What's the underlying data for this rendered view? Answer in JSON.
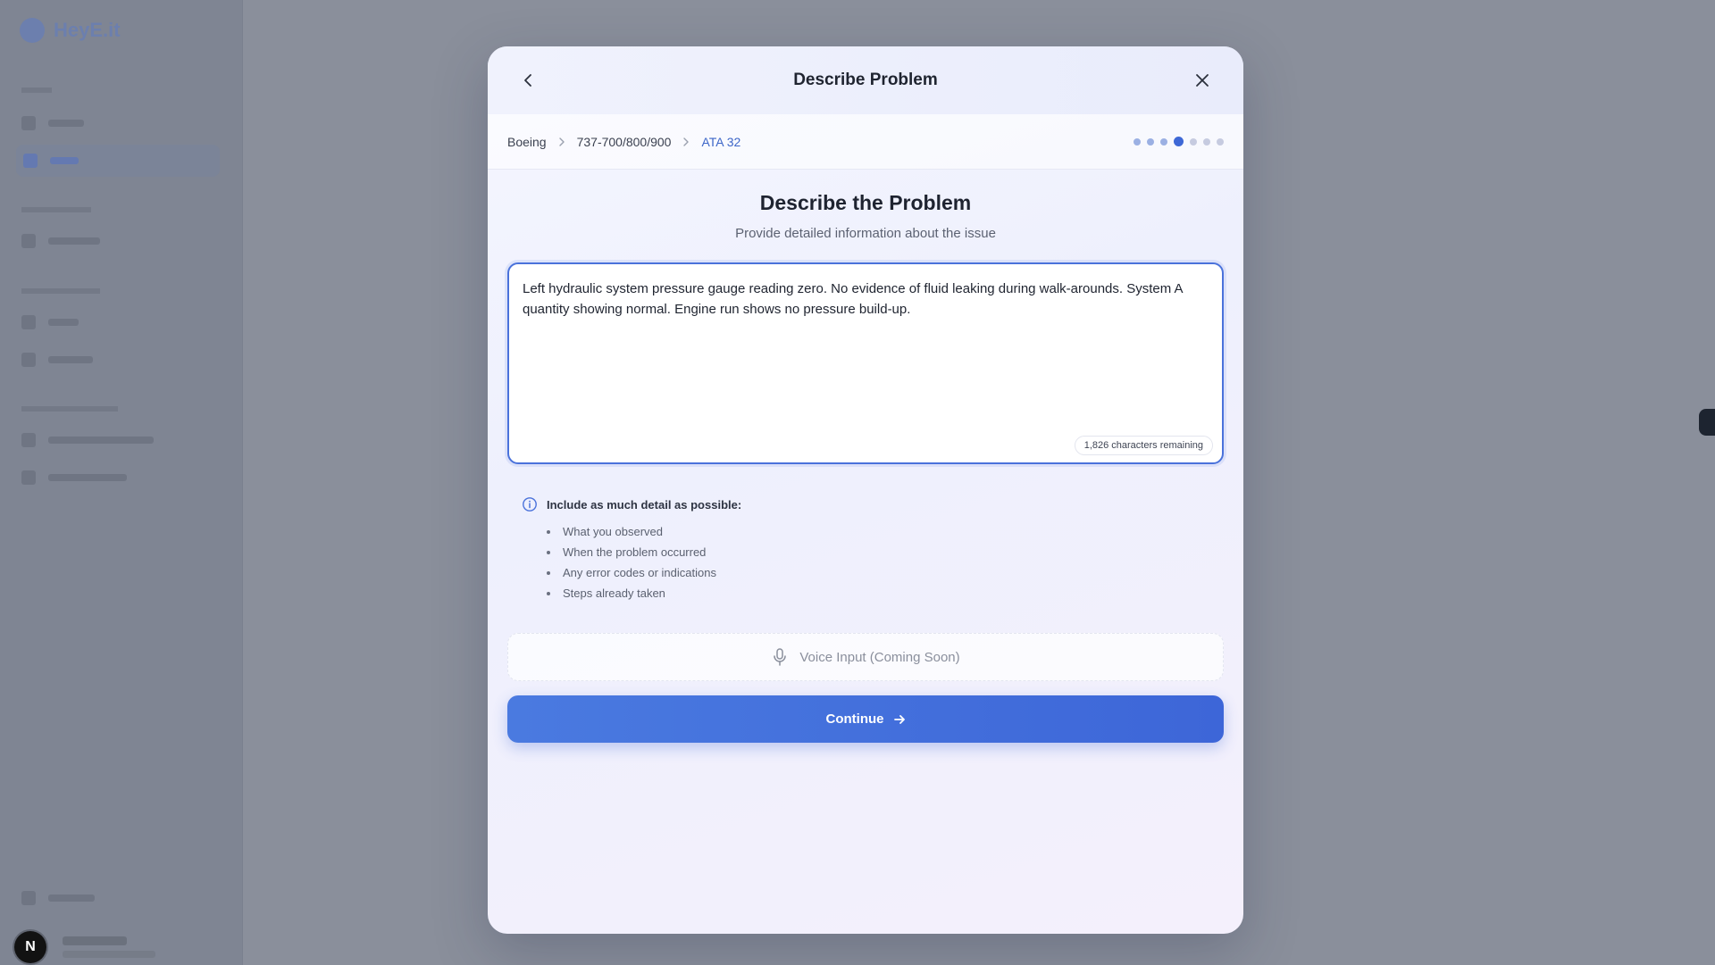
{
  "app": {
    "logo_text": "HeyE.it"
  },
  "modal": {
    "title": "Describe Problem",
    "breadcrumb": [
      "Boeing",
      "737-700/800/900",
      "ATA 32"
    ],
    "steps": {
      "total": 7,
      "current": 4
    },
    "heading": "Describe the Problem",
    "subheading": "Provide detailed information about the issue",
    "problem_text": "Left hydraulic system pressure gauge reading zero. No evidence of fluid leaking during walk-arounds. System A quantity showing normal. Engine run shows no pressure build-up.",
    "char_remaining": "1,826 characters remaining",
    "tips_title": "Include as much detail as possible:",
    "tips": [
      "What you observed",
      "When the problem occurred",
      "Any error codes or indications",
      "Steps already taken"
    ],
    "voice_label": "Voice Input (Coming Soon)",
    "continue_label": "Continue"
  },
  "user": {
    "avatar_initial": "N"
  },
  "colors": {
    "accent": "#3e68d6",
    "overlay": "#8a8f9b"
  }
}
